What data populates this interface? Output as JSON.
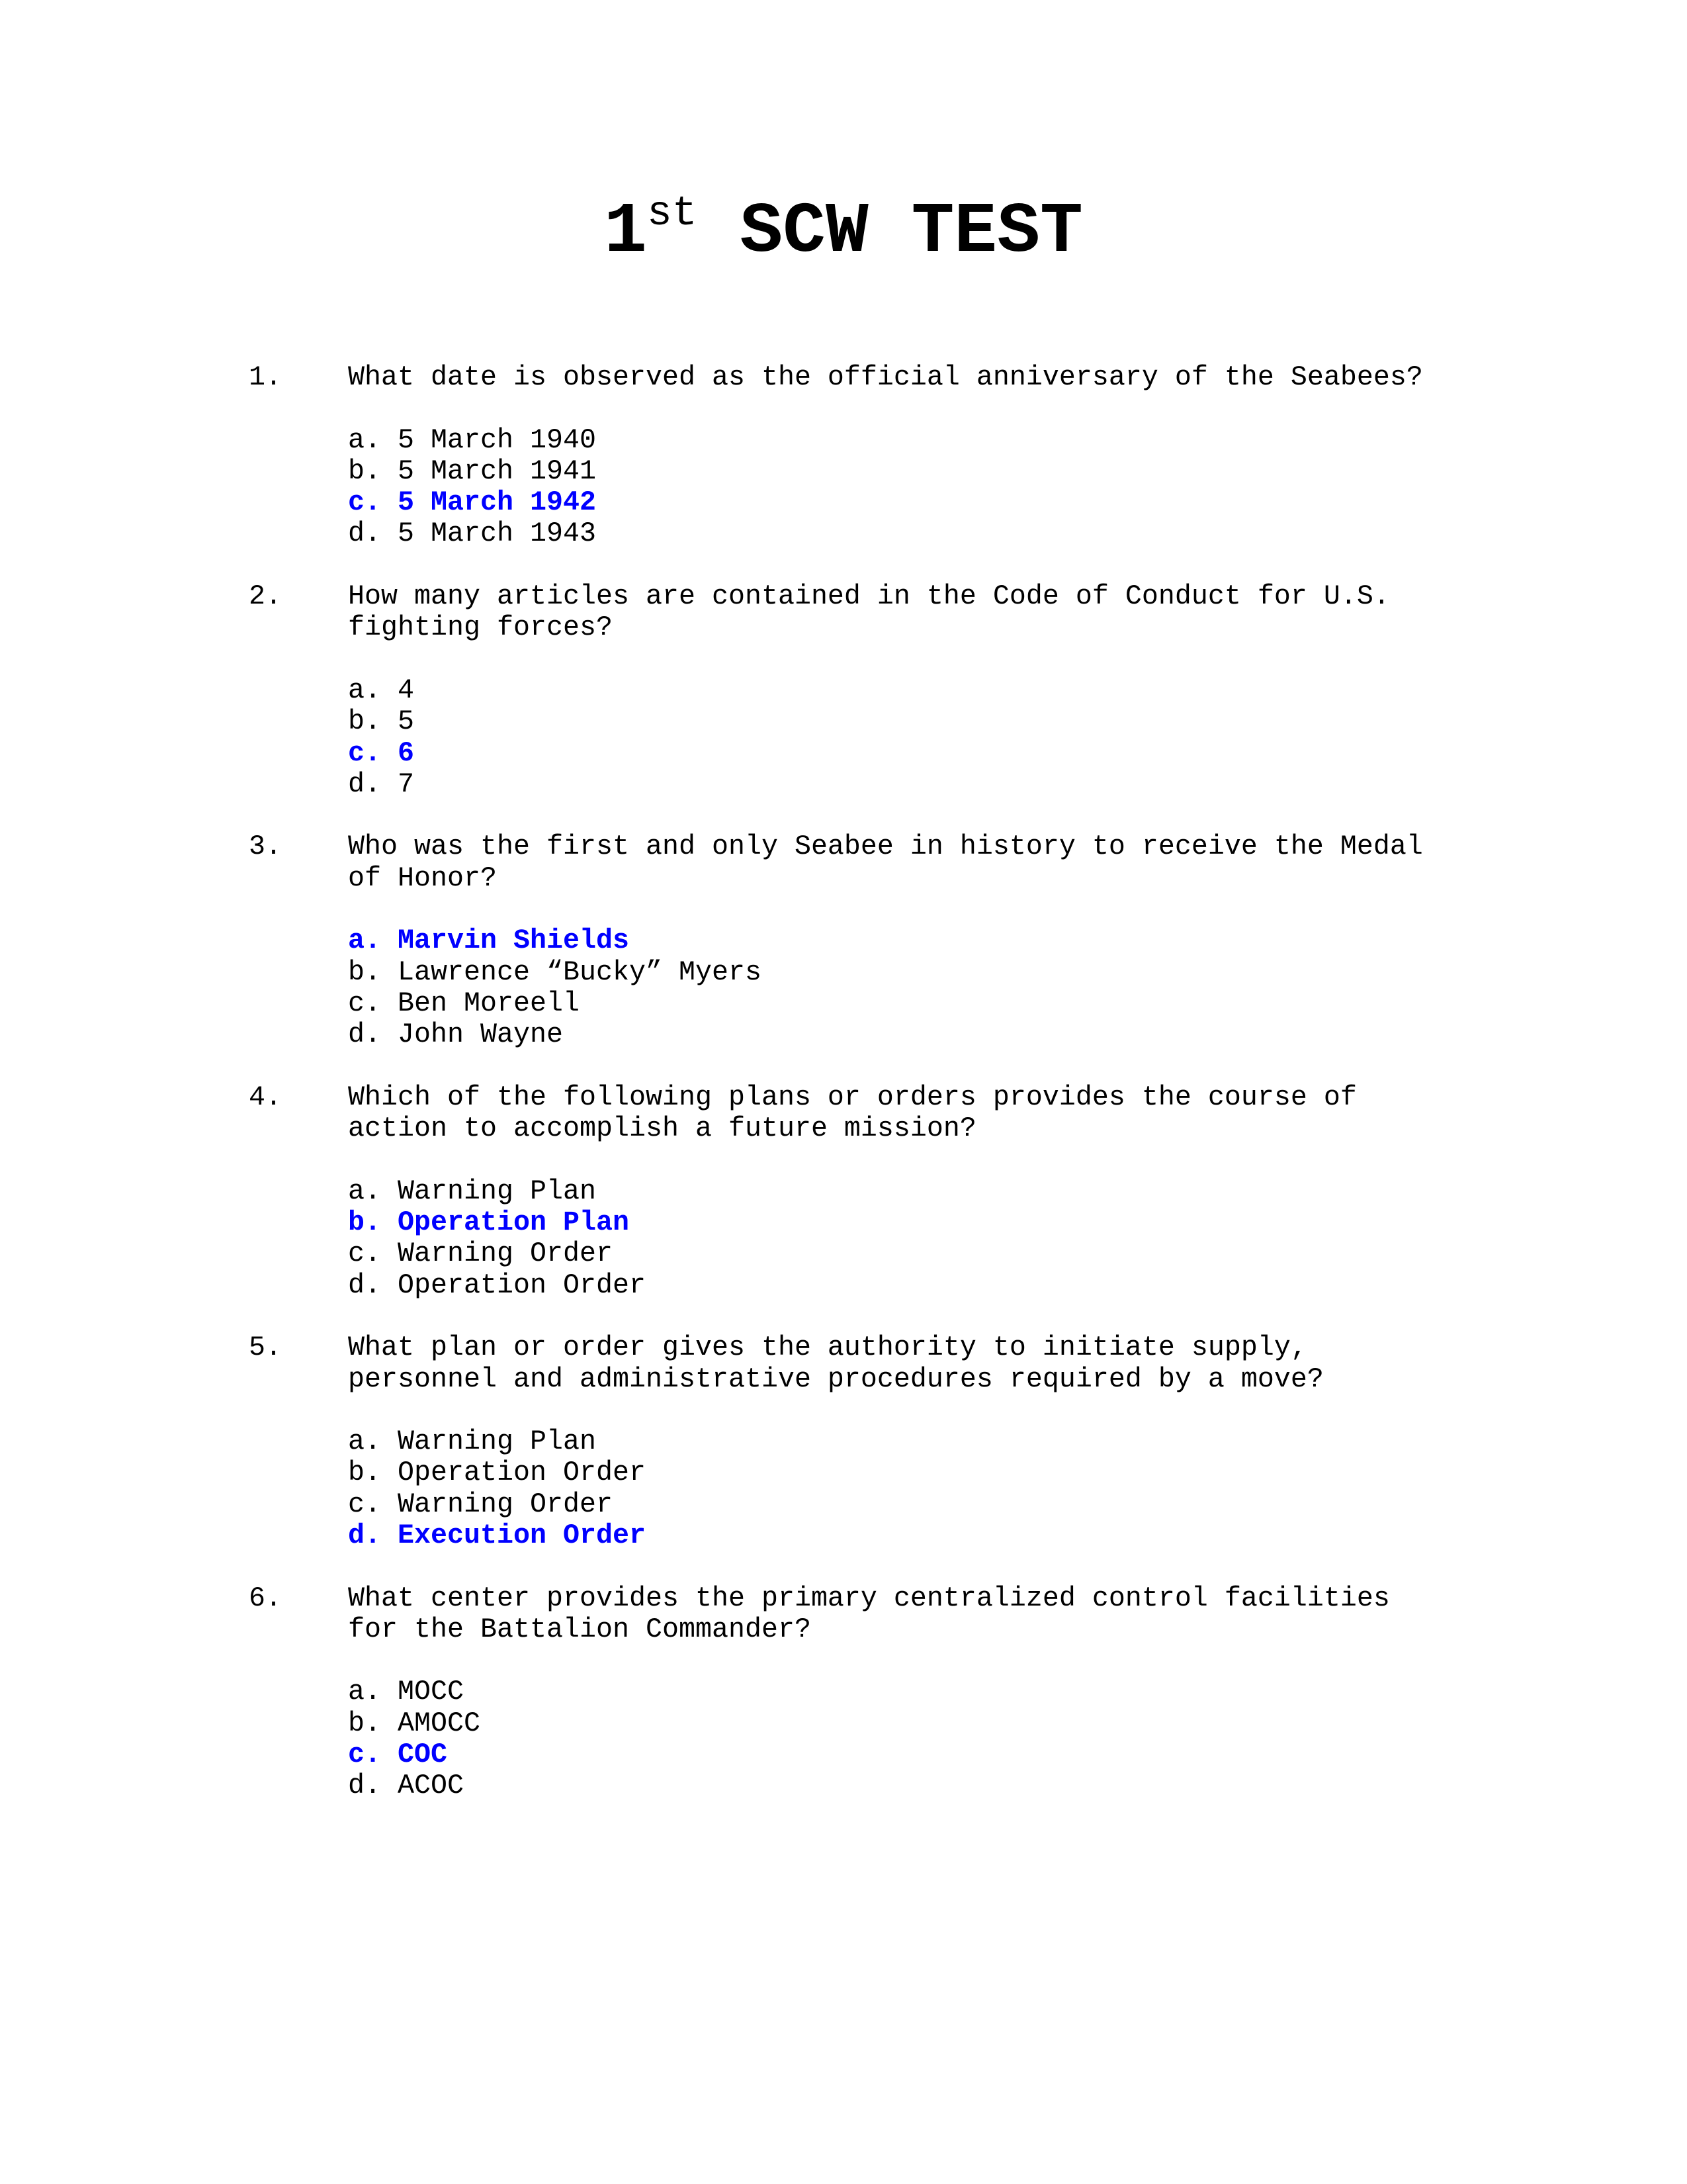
{
  "document": {
    "title_main_number": "1",
    "title_superscript": "st",
    "title_rest": " SCW TEST",
    "highlight_color": "#0000ff"
  },
  "questions": [
    {
      "number": "1.",
      "text": "What date is observed as the official anniversary of the Seabees?",
      "options": [
        {
          "letter": "a.",
          "text": "5 March 1940",
          "correct": false
        },
        {
          "letter": "b.",
          "text": "5 March 1941",
          "correct": false
        },
        {
          "letter": "c.",
          "text": "5 March 1942",
          "correct": true
        },
        {
          "letter": "d.",
          "text": "5 March 1943",
          "correct": false
        }
      ]
    },
    {
      "number": "2.",
      "text": "How many articles are contained in the Code of Conduct for U.S.\nfighting forces?",
      "options": [
        {
          "letter": "a.",
          "text": "4",
          "correct": false
        },
        {
          "letter": "b.",
          "text": "5",
          "correct": false
        },
        {
          "letter": "c.",
          "text": "6",
          "correct": true
        },
        {
          "letter": "d.",
          "text": "7",
          "correct": false
        }
      ]
    },
    {
      "number": "3.",
      "text": "Who was the first and only Seabee in history to receive the Medal\nof Honor?",
      "options": [
        {
          "letter": "a.",
          "text": "Marvin Shields",
          "correct": true
        },
        {
          "letter": "b.",
          "text": "Lawrence “Bucky” Myers",
          "correct": false
        },
        {
          "letter": "c.",
          "text": "Ben Moreell",
          "correct": false
        },
        {
          "letter": "d.",
          "text": "John Wayne",
          "correct": false
        }
      ]
    },
    {
      "number": "4.",
      "text": "Which of the following plans or orders provides the course of\naction to accomplish a future mission?",
      "options": [
        {
          "letter": "a.",
          "text": "Warning Plan",
          "correct": false
        },
        {
          "letter": "b.",
          "text": "Operation Plan",
          "correct": true
        },
        {
          "letter": "c.",
          "text": "Warning Order",
          "correct": false
        },
        {
          "letter": "d.",
          "text": "Operation Order",
          "correct": false
        }
      ]
    },
    {
      "number": "5.",
      "text": "What plan or order gives the authority to initiate supply,\npersonnel and administrative procedures required by a move?",
      "options": [
        {
          "letter": "a.",
          "text": "Warning Plan",
          "correct": false
        },
        {
          "letter": "b.",
          "text": "Operation Order",
          "correct": false
        },
        {
          "letter": "c.",
          "text": "Warning Order",
          "correct": false
        },
        {
          "letter": "d.",
          "text": "Execution Order",
          "correct": true
        }
      ]
    },
    {
      "number": "6.",
      "text": "What center provides the primary centralized control facilities\nfor the Battalion Commander?",
      "options": [
        {
          "letter": "a.",
          "text": "MOCC",
          "correct": false
        },
        {
          "letter": "b.",
          "text": "AMOCC",
          "correct": false
        },
        {
          "letter": "c.",
          "text": "COC",
          "correct": true
        },
        {
          "letter": "d.",
          "text": "ACOC",
          "correct": false
        }
      ]
    }
  ]
}
